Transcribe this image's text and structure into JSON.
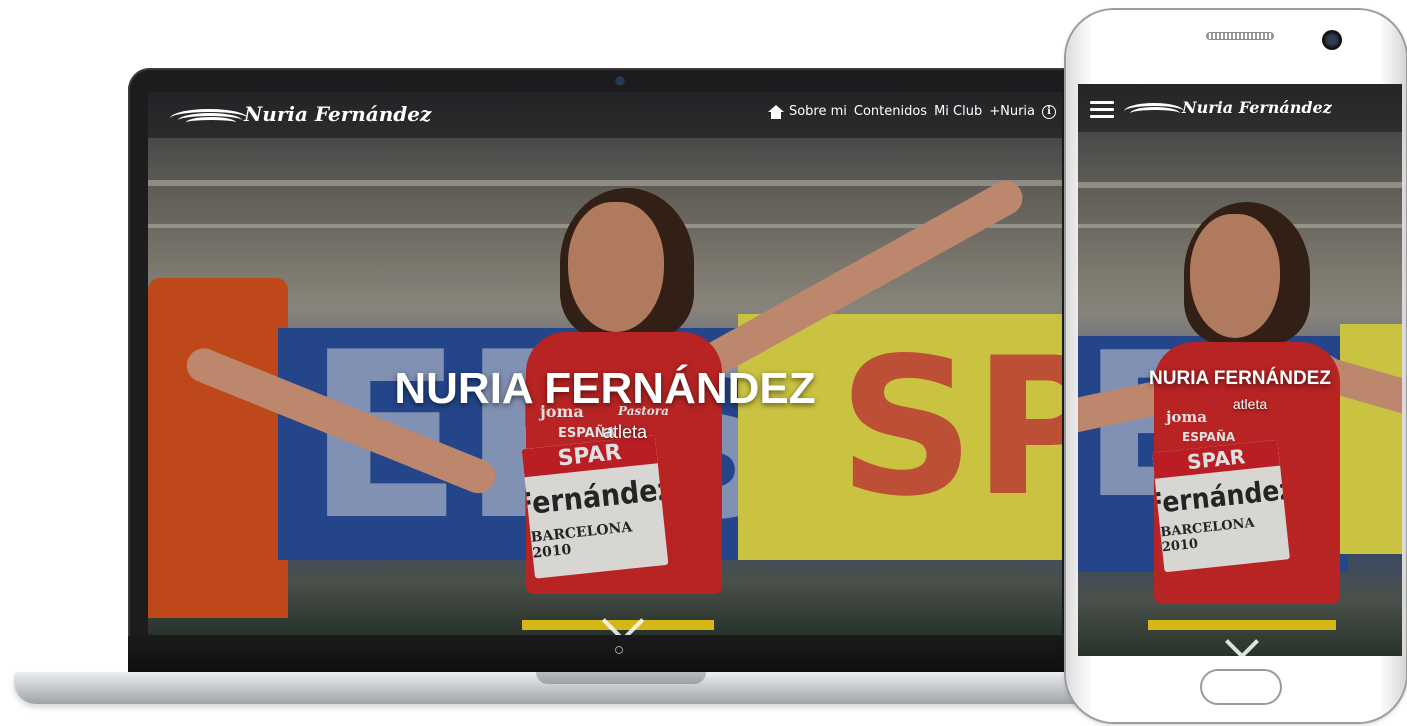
{
  "site": {
    "logo_text": "Nuria Fernández",
    "nav": [
      {
        "label": "Sobre mi",
        "icon": "home-icon"
      },
      {
        "label": "Contenidos"
      },
      {
        "label": "Mi Club"
      },
      {
        "label": "+Nuria"
      }
    ],
    "info_icon": "info-icon",
    "hero_title": "NURIA FERNÁNDEZ",
    "hero_subtitle": "atleta",
    "scroll_icon": "chevron-down-icon"
  },
  "photo_text": {
    "jersey_brand": "joma",
    "jersey_country": "ESPAÑA",
    "jersey_sponsor": "Pastora",
    "bib_sponsor": "SPAR",
    "bib_name": "Fernández",
    "bib_event": "BARCELONA 2010",
    "banner_left": "EPSO",
    "banner_right": "SPOR"
  },
  "colors": {
    "nav_overlay": "#141414",
    "title": "#ffffff",
    "jersey_red": "#d12a28",
    "banner_blue": "#2a4f9e",
    "banner_yellow": "#e6df4a"
  }
}
